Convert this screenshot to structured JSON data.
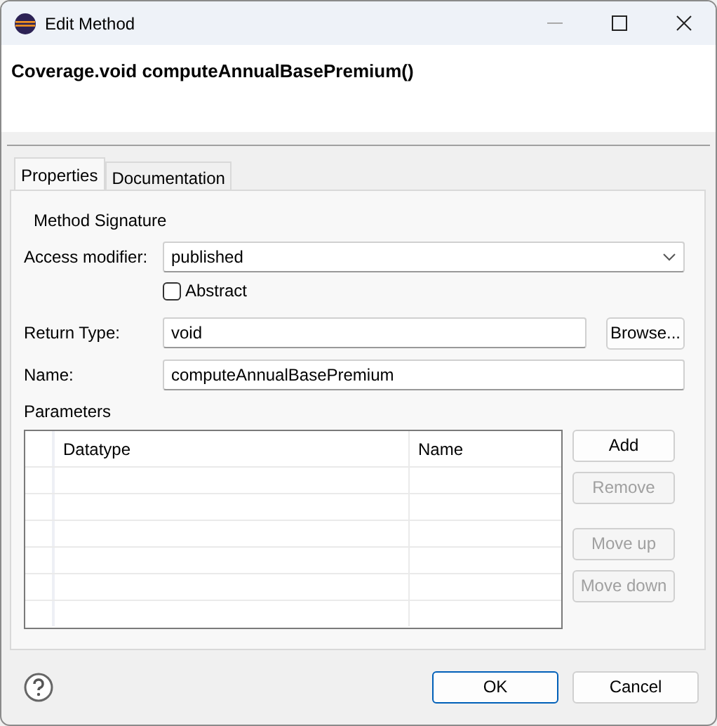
{
  "window": {
    "title": "Edit Method"
  },
  "header": {
    "title": "Coverage.void computeAnnualBasePremium()"
  },
  "tabs": [
    {
      "label": "Properties",
      "selected": true
    },
    {
      "label": "Documentation",
      "selected": false
    }
  ],
  "form": {
    "section_title": "Method Signature",
    "access_modifier": {
      "label": "Access modifier:",
      "value": "published"
    },
    "abstract": {
      "label": "Abstract",
      "checked": false
    },
    "return_type": {
      "label": "Return Type:",
      "value": "void",
      "button": "Browse..."
    },
    "name": {
      "label": "Name:",
      "value": "computeAnnualBasePremium"
    },
    "parameters": {
      "label": "Parameters",
      "columns": [
        "Datatype",
        "Name"
      ],
      "buttons": [
        {
          "label": "Add",
          "disabled": false
        },
        {
          "label": "Remove",
          "disabled": true
        },
        {
          "label": "Move up",
          "disabled": true
        },
        {
          "label": "Move down",
          "disabled": true
        }
      ]
    }
  },
  "footer": {
    "buttons": [
      {
        "label": "OK",
        "default": true
      },
      {
        "label": "Cancel",
        "default": false
      }
    ]
  }
}
